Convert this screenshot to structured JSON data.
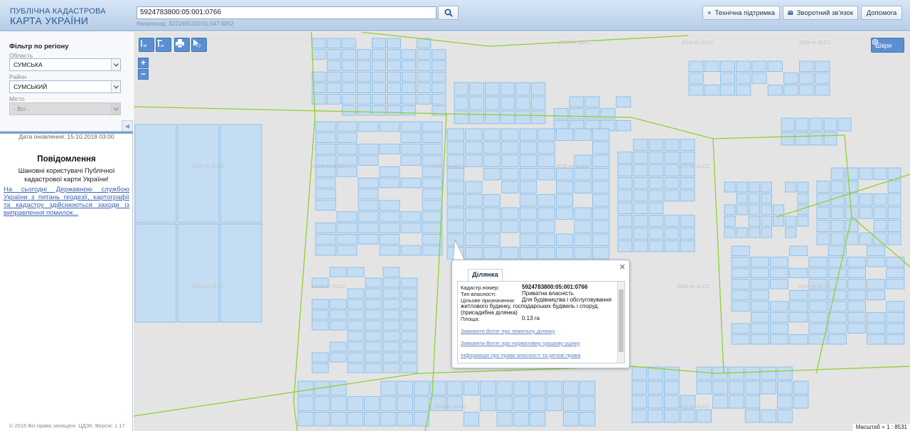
{
  "app": {
    "title_line1": "ПУБЛІЧНА КАДАСТРОВА",
    "title_line2": "КАРТА УКРАЇНИ"
  },
  "search": {
    "value": "5924783800:05:001:0766",
    "hint": "Наприклад: 3221655100:01:047:0052"
  },
  "header_buttons": {
    "support": "Технічна підтримка",
    "feedback": "Зворотний зв'язок",
    "help": "Допомога"
  },
  "filter": {
    "title": "Фільтр по регіону",
    "oblast_label": "Область",
    "oblast_value": "СУМСЬКА",
    "raion_label": "Район",
    "raion_value": "СУМСЬКИЙ",
    "city_label": "Місто",
    "city_value": "- Всі -"
  },
  "update_date": "Дата оновлення: 15.10.2018 03:00",
  "notice": {
    "title": "Повідомлення",
    "body": "Шановні користувачі Публічної кадастрової карти України!",
    "link": "На сьогодні Державною службою України з питань геодезії, картографії та кадастру здійснюються заходи із виправлення помилок..."
  },
  "copyright": "© 2016 Всі права захищені. ЦДЗК. Версія: 1.17",
  "map_tools": {
    "layers_label": "Шари",
    "watermark": "2018 не SLCC"
  },
  "popup": {
    "tab": "Ділянка",
    "rows": [
      {
        "label": "Кадастр.номер:",
        "value": "5924783800:05:001:0766"
      },
      {
        "label": "Тип власності:",
        "value": "Приватна власність"
      },
      {
        "label": "Цільове призначення:",
        "value": "Для будівництва і обслуговування житлового будинку, господарських будівель і споруд (присадибна ділянка)"
      },
      {
        "label": "Площа:",
        "value": "0.13 га"
      }
    ],
    "links": [
      "Замовити Витяг про земельну ділянку",
      "Замовити Витяг про нормативну грошову оцінку",
      "Інформація про право власності та речові права"
    ]
  },
  "scale": "Масштаб = 1 : 8531",
  "colors": {
    "parcel_fill": "#c5ddf2",
    "parcel_stroke": "#74b4e8",
    "boundary": "#8fcf30",
    "map_bg": "#e4e4e4",
    "accent": "#5b8fd0"
  }
}
